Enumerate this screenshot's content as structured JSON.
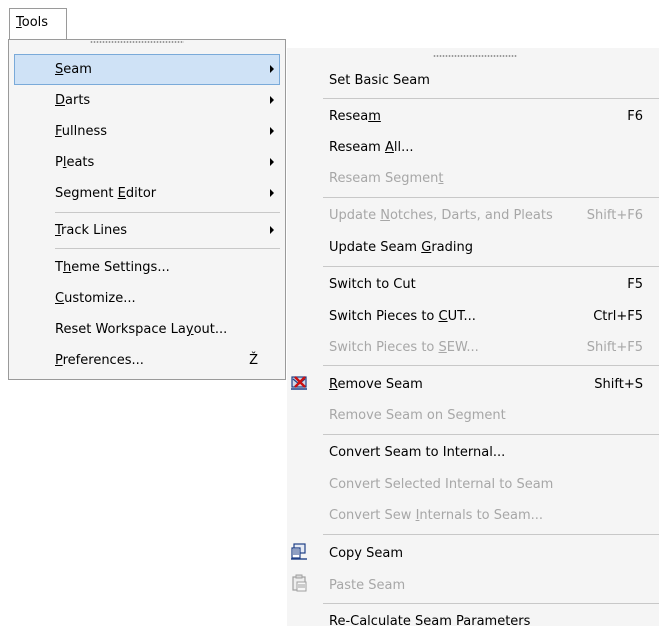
{
  "menubar": {
    "tools_label": "Tools"
  },
  "tools_menu": {
    "items": [
      {
        "label": "Seam",
        "submenu": true,
        "highlighted": true
      },
      {
        "label": "Darts",
        "submenu": true
      },
      {
        "label": "Fullness",
        "submenu": true
      },
      {
        "label": "Pleats",
        "submenu": true
      },
      {
        "label": "Segment Editor",
        "submenu": true
      },
      {
        "label": "Track Lines",
        "submenu": true
      },
      {
        "label": "Theme Settings..."
      },
      {
        "label": "Customize..."
      },
      {
        "label": "Reset Workspace Layout..."
      },
      {
        "label": "Preferences...",
        "shortcut": "Ž"
      }
    ]
  },
  "seam_menu": {
    "items": [
      {
        "label": "Set Basic Seam",
        "shortcut": ""
      },
      {
        "label": "Reseam",
        "shortcut": "F6"
      },
      {
        "label": "Reseam All...",
        "shortcut": ""
      },
      {
        "label": "Reseam Segment",
        "shortcut": "",
        "disabled": true
      },
      {
        "label": "Update Notches, Darts, and Pleats",
        "shortcut": "Shift+F6",
        "disabled": true
      },
      {
        "label": "Update Seam Grading",
        "shortcut": ""
      },
      {
        "label": "Switch to Cut",
        "shortcut": "F5"
      },
      {
        "label": "Switch Pieces to CUT...",
        "shortcut": "Ctrl+F5"
      },
      {
        "label": "Switch Pieces to SEW...",
        "shortcut": "Shift+F5",
        "disabled": true
      },
      {
        "label": "Remove Seam",
        "shortcut": "Shift+S",
        "icon": "remove-seam-icon"
      },
      {
        "label": "Remove Seam on Segment",
        "shortcut": "",
        "disabled": true
      },
      {
        "label": "Convert Seam to Internal...",
        "shortcut": ""
      },
      {
        "label": "Convert Selected Internal to Seam",
        "shortcut": "",
        "disabled": true
      },
      {
        "label": "Convert Sew Internals to Seam...",
        "shortcut": "",
        "disabled": true
      },
      {
        "label": "Copy Seam",
        "shortcut": "",
        "icon": "copy-seam-icon"
      },
      {
        "label": "Paste Seam",
        "shortcut": "",
        "disabled": true,
        "icon": "paste-seam-icon"
      },
      {
        "label": "Re-Calculate Seam Parameters",
        "shortcut": ""
      }
    ]
  },
  "colors": {
    "highlight_bg": "#cfe2f6",
    "highlight_border": "#7aaad9",
    "disabled_text": "#a7a7a7"
  }
}
